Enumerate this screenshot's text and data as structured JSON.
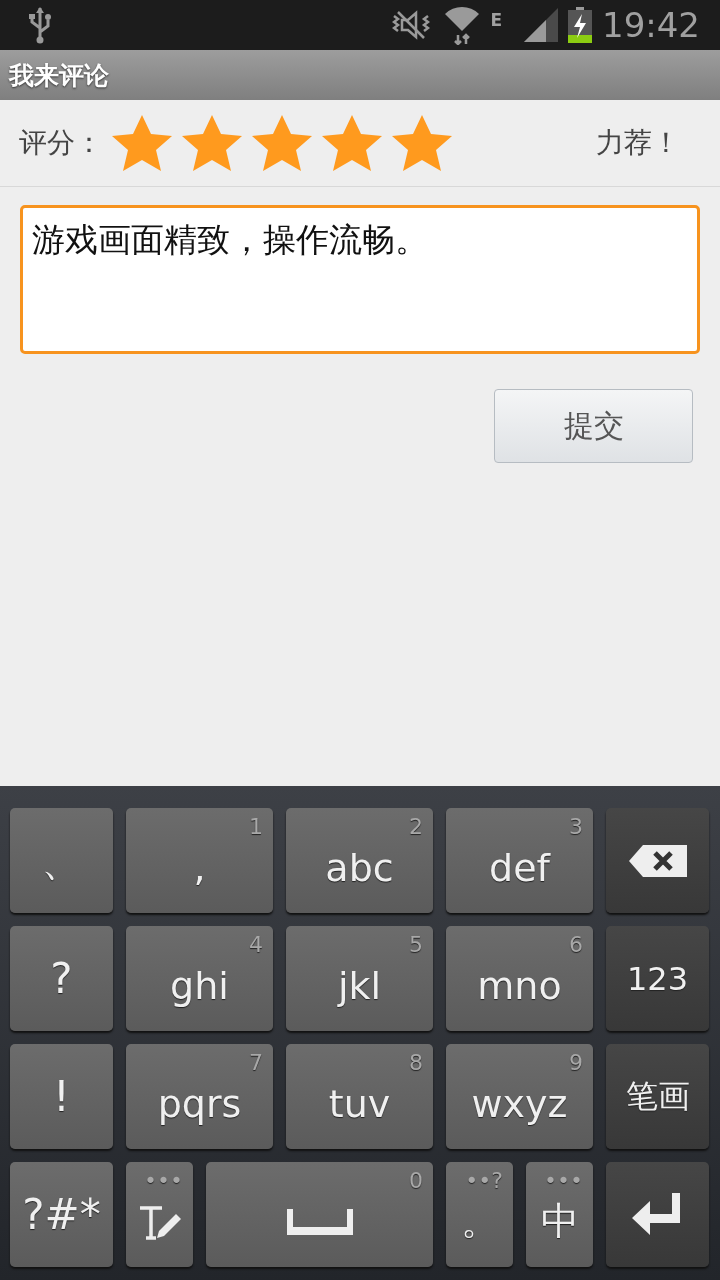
{
  "status_bar": {
    "network": "E",
    "time": "19:42"
  },
  "title_bar": {
    "title": "我来评论"
  },
  "rating": {
    "label": "评分：",
    "stars": 5,
    "verdict": "力荐！"
  },
  "comment": {
    "value": "游戏画面精致，操作流畅。",
    "focused": true
  },
  "submit_button": {
    "label": "提交"
  },
  "keyboard": {
    "rows": [
      [
        {
          "kind": "punct",
          "label": "、"
        },
        {
          "kind": "letters",
          "label": ",",
          "hint": "1"
        },
        {
          "kind": "letters",
          "label": "abc",
          "hint": "2"
        },
        {
          "kind": "letters",
          "label": "def",
          "hint": "3"
        },
        {
          "kind": "backspace"
        }
      ],
      [
        {
          "kind": "punct",
          "label": "?"
        },
        {
          "kind": "letters",
          "label": "ghi",
          "hint": "4"
        },
        {
          "kind": "letters",
          "label": "jkl",
          "hint": "5"
        },
        {
          "kind": "letters",
          "label": "mno",
          "hint": "6"
        },
        {
          "kind": "function",
          "label": "123"
        }
      ],
      [
        {
          "kind": "punct",
          "label": "!"
        },
        {
          "kind": "letters",
          "label": "pqrs",
          "hint": "7"
        },
        {
          "kind": "letters",
          "label": "tuv",
          "hint": "8"
        },
        {
          "kind": "letters",
          "label": "wxyz",
          "hint": "9"
        },
        {
          "kind": "function",
          "label": "笔画"
        }
      ]
    ],
    "bottom_keys": [
      {
        "kind": "punct",
        "label": "?#*"
      },
      {
        "kind": "handwriting",
        "hint": "•••"
      },
      {
        "kind": "space",
        "hint": "0"
      },
      {
        "kind": "small",
        "label": "。",
        "hint": "••?"
      },
      {
        "kind": "small",
        "label": "中",
        "hint": "•••"
      },
      {
        "kind": "enter"
      }
    ]
  }
}
